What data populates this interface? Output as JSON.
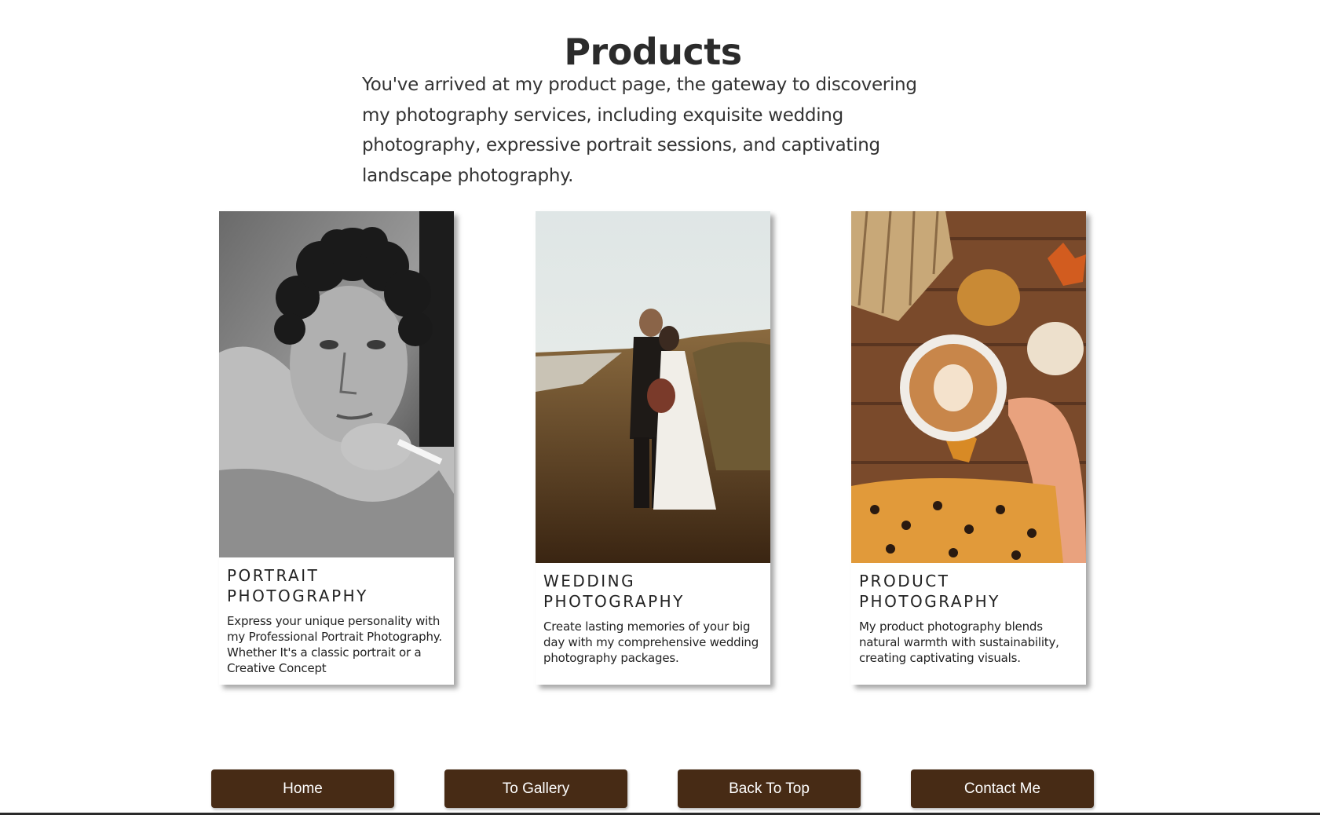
{
  "header": {
    "title": "Products",
    "intro": "You've arrived at my product page, the gateway to discovering my photography services, including exquisite wedding photography, expressive portrait sessions, and captivating landscape photography."
  },
  "products": [
    {
      "title": "PORTRAIT PHOTOGRAPHY",
      "description": "Express your unique personality with my Professional Portrait Photography. Whether It's a classic portrait or a Creative Concept"
    },
    {
      "title": "WEDDING PHOTOGRAPHY",
      "description": "Create lasting memories of your big day with my comprehensive wedding photography packages."
    },
    {
      "title": "PRODUCT PHOTOGRAPHY",
      "description": "My product photography blends natural warmth with sustainability, creating captivating visuals."
    }
  ],
  "nav": {
    "home": "Home",
    "gallery": "To Gallery",
    "top": "Back To Top",
    "contact": "Contact Me"
  },
  "colors": {
    "button_bg": "#472b15",
    "button_text": "#ffffff",
    "text": "#222222"
  }
}
